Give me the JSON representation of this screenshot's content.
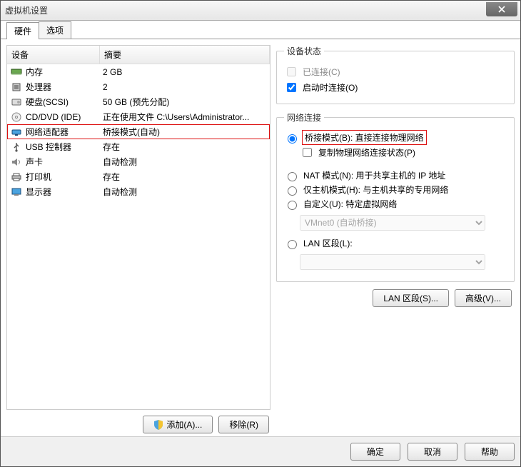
{
  "window": {
    "title": "虚拟机设置"
  },
  "tabs": {
    "hardware": "硬件",
    "options": "选项"
  },
  "list_header": {
    "device": "设备",
    "summary": "摘要"
  },
  "devices": [
    {
      "icon": "memory",
      "name": "内存",
      "summary": "2 GB"
    },
    {
      "icon": "cpu",
      "name": "处理器",
      "summary": "2"
    },
    {
      "icon": "disk",
      "name": "硬盘(SCSI)",
      "summary": "50 GB (预先分配)"
    },
    {
      "icon": "cd",
      "name": "CD/DVD (IDE)",
      "summary": "正在使用文件 C:\\Users\\Administrator..."
    },
    {
      "icon": "network",
      "name": "网络适配器",
      "summary": "桥接模式(自动)"
    },
    {
      "icon": "usb",
      "name": "USB 控制器",
      "summary": "存在"
    },
    {
      "icon": "sound",
      "name": "声卡",
      "summary": "自动检测"
    },
    {
      "icon": "printer",
      "name": "打印机",
      "summary": "存在"
    },
    {
      "icon": "display",
      "name": "显示器",
      "summary": "自动检测"
    }
  ],
  "selected_device_index": 4,
  "left_buttons": {
    "add": "添加(A)...",
    "remove": "移除(R)"
  },
  "device_status": {
    "legend": "设备状态",
    "connected": "已连接(C)",
    "connect_at_startup": "启动时连接(O)"
  },
  "network_connection": {
    "legend": "网络连接",
    "bridged": "桥接模式(B): 直接连接物理网络",
    "replicate": "复制物理网络连接状态(P)",
    "nat": "NAT 模式(N): 用于共享主机的 IP 地址",
    "hostonly": "仅主机模式(H): 与主机共享的专用网络",
    "custom": "自定义(U): 特定虚拟网络",
    "custom_value": "VMnet0 (自动桥接)",
    "lan_segment": "LAN 区段(L):",
    "lan_segments_btn": "LAN 区段(S)...",
    "advanced_btn": "高级(V)..."
  },
  "footer": {
    "ok": "确定",
    "cancel": "取消",
    "help": "帮助"
  }
}
